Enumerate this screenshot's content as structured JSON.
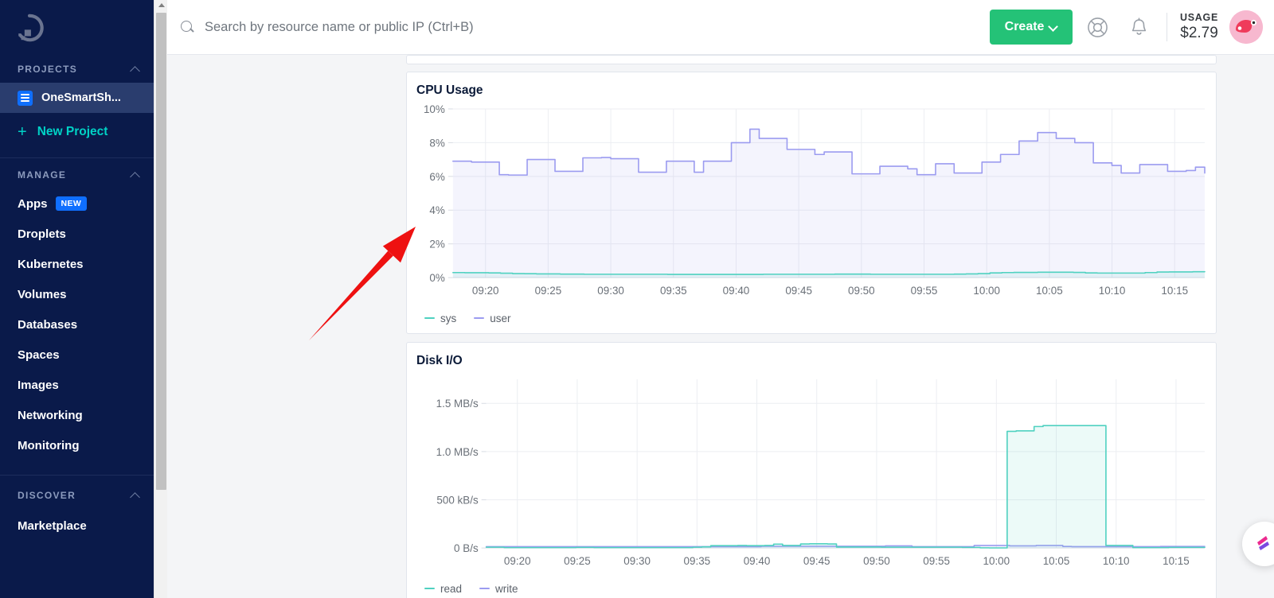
{
  "sidebar": {
    "logo_icon": "digitalocean-logo-icon",
    "sections": [
      {
        "title": "PROJECTS",
        "collapse_icon": "chevron-up-icon",
        "project": {
          "label": "OneSmartSh...",
          "icon": "project-list-icon"
        },
        "new_project": {
          "label": "New Project",
          "icon": "plus-icon"
        }
      },
      {
        "title": "MANAGE",
        "collapse_icon": "chevron-up-icon",
        "items": [
          {
            "label": "Apps",
            "badge": "NEW"
          },
          {
            "label": "Droplets"
          },
          {
            "label": "Kubernetes"
          },
          {
            "label": "Volumes"
          },
          {
            "label": "Databases"
          },
          {
            "label": "Spaces"
          },
          {
            "label": "Images"
          },
          {
            "label": "Networking"
          },
          {
            "label": "Monitoring"
          }
        ]
      },
      {
        "title": "DISCOVER",
        "collapse_icon": "chevron-up-icon",
        "items": [
          {
            "label": "Marketplace"
          }
        ]
      }
    ]
  },
  "topbar": {
    "search": {
      "icon": "search-icon",
      "placeholder": "Search by resource name or public IP (Ctrl+B)",
      "value": ""
    },
    "create_button": {
      "label": "Create",
      "icon": "chevron-down-icon",
      "color": "#24c277"
    },
    "help_icon": "lifebuoy-help-icon",
    "notifications_icon": "bell-icon",
    "usage": {
      "label": "USAGE",
      "amount": "$2.79"
    },
    "avatar": {
      "name": "user-avatar",
      "color": "#f5a9c6"
    }
  },
  "colors": {
    "sidebar_bg": "#0a1a4a",
    "sidebar_active": "#2a3d6e",
    "accent_teal": "#00d2c6",
    "accent_blue": "#0f6fff",
    "series_sys": "#4fd1c0",
    "series_user": "#9b9bf0",
    "annotation_red": "#ee1111"
  },
  "annotation": {
    "type": "red-arrow",
    "from": [
      388,
      428
    ],
    "to": [
      522,
      285
    ]
  },
  "fab": {
    "name": "feedback-fab",
    "icon": "arrows-icon"
  },
  "chart_data": [
    {
      "type": "area",
      "title": "CPU Usage",
      "xlabel": "",
      "ylabel": "",
      "ylim": [
        0,
        10
      ],
      "yticks": [
        "0%",
        "2%",
        "4%",
        "6%",
        "8%",
        "10%"
      ],
      "ytick_values": [
        0,
        2,
        4,
        6,
        8,
        10
      ],
      "xticks": [
        "09:20",
        "09:25",
        "09:30",
        "09:35",
        "09:40",
        "09:45",
        "09:50",
        "09:55",
        "10:00",
        "10:05",
        "10:10",
        "10:15"
      ],
      "grid": true,
      "legend_position": "bottom-left",
      "series": [
        {
          "name": "sys",
          "color": "#4fd1c0",
          "values": [
            0.3,
            0.29,
            0.29,
            0.28,
            0.26,
            0.24,
            0.23,
            0.22,
            0.22,
            0.21,
            0.21,
            0.2,
            0.2,
            0.2,
            0.2,
            0.2,
            0.2,
            0.2,
            0.19,
            0.19,
            0.19,
            0.19,
            0.19,
            0.19,
            0.19,
            0.19,
            0.2,
            0.2,
            0.2,
            0.2,
            0.2,
            0.2,
            0.21,
            0.21,
            0.21,
            0.2,
            0.2,
            0.2,
            0.2,
            0.2,
            0.2,
            0.2,
            0.21,
            0.22,
            0.24,
            0.28,
            0.3,
            0.31,
            0.31,
            0.32,
            0.32,
            0.32,
            0.31,
            0.28,
            0.27,
            0.27,
            0.27,
            0.27,
            0.3,
            0.33,
            0.34,
            0.34,
            0.35,
            0.35
          ]
        },
        {
          "name": "user",
          "color": "#9b9bf0",
          "values": [
            6.9,
            6.9,
            6.85,
            6.85,
            6.85,
            6.1,
            6.08,
            6.08,
            7.0,
            7.0,
            7.0,
            6.3,
            6.3,
            6.3,
            7.1,
            7.1,
            7.12,
            7.05,
            7.05,
            7.05,
            6.25,
            6.25,
            6.25,
            6.9,
            6.9,
            6.9,
            6.25,
            6.9,
            6.9,
            6.9,
            8.0,
            8.0,
            8.8,
            8.25,
            8.25,
            8.25,
            7.6,
            7.6,
            7.6,
            7.3,
            7.45,
            7.45,
            7.45,
            6.15,
            6.15,
            6.15,
            6.6,
            6.6,
            6.6,
            6.45,
            6.1,
            6.1,
            6.75,
            6.75,
            6.2,
            6.2,
            6.2,
            6.85,
            6.85,
            7.3,
            7.3,
            8.1,
            8.1,
            8.6,
            8.6,
            8.25,
            8.25,
            8.0,
            8.0,
            6.8,
            6.8,
            6.65,
            6.2,
            6.2,
            6.7,
            6.7,
            6.7,
            6.3,
            6.3,
            6.35,
            6.55,
            6.2
          ]
        }
      ]
    },
    {
      "type": "area",
      "title": "Disk I/O",
      "xlabel": "",
      "ylabel": "",
      "ylim": [
        0,
        1750000
      ],
      "yticks": [
        "0 B/s",
        "500 kB/s",
        "1.0 MB/s",
        "1.5 MB/s"
      ],
      "ytick_values": [
        0,
        500000,
        1000000,
        1500000
      ],
      "xticks": [
        "09:20",
        "09:25",
        "09:30",
        "09:35",
        "09:40",
        "09:45",
        "09:50",
        "09:55",
        "10:00",
        "10:05",
        "10:10",
        "10:15"
      ],
      "grid": true,
      "legend_position": "bottom-left",
      "series": [
        {
          "name": "read",
          "color": "#4fd1c0",
          "values": [
            8000,
            8000,
            4000,
            4000,
            4000,
            4000,
            4000,
            4000,
            4000,
            4000,
            6000,
            6000,
            4000,
            4000,
            4000,
            4000,
            4000,
            4000,
            4000,
            4000,
            4000,
            4000,
            4000,
            8000,
            12000,
            24000,
            24000,
            24000,
            26000,
            24000,
            24000,
            26000,
            40000,
            26000,
            26000,
            42000,
            44000,
            44000,
            42000,
            10000,
            10000,
            10000,
            10000,
            10000,
            8000,
            8000,
            8000,
            8000,
            8000,
            8000,
            8000,
            8000,
            8000,
            6000,
            6000,
            2000,
            1000,
            1000,
            1210000,
            1215000,
            1215000,
            1260000,
            1270000,
            1270000,
            1270000,
            1270000,
            1270000,
            1270000,
            1270000,
            26000,
            26000,
            26000,
            4000,
            4000,
            4000,
            4000,
            6000,
            6000,
            6000,
            6000,
            6000
          ]
        },
        {
          "name": "write",
          "color": "#9b9bf0",
          "values": [
            14000,
            14000,
            14000,
            14000,
            14000,
            14000,
            14000,
            14000,
            14000,
            14000,
            14000,
            14000,
            14000,
            14000,
            14000,
            14000,
            14000,
            14000,
            14000,
            14000,
            14000,
            14000,
            14000,
            14000,
            14000,
            14000,
            14000,
            14000,
            14000,
            14000,
            14000,
            18000,
            18000,
            18000,
            18000,
            18000,
            18000,
            18000,
            18000,
            18000,
            18000,
            18000,
            18000,
            18000,
            18000,
            22000,
            22000,
            22000,
            14000,
            14000,
            14000,
            14000,
            14000,
            14000,
            14000,
            26000,
            26000,
            26000,
            26000,
            22000,
            22000,
            22000,
            26000,
            26000,
            26000,
            16000,
            14000,
            14000,
            14000,
            14000,
            14000,
            14000,
            14000,
            14000,
            14000,
            14000,
            16000,
            16000,
            16000,
            16000,
            16000,
            16000
          ]
        }
      ]
    }
  ]
}
